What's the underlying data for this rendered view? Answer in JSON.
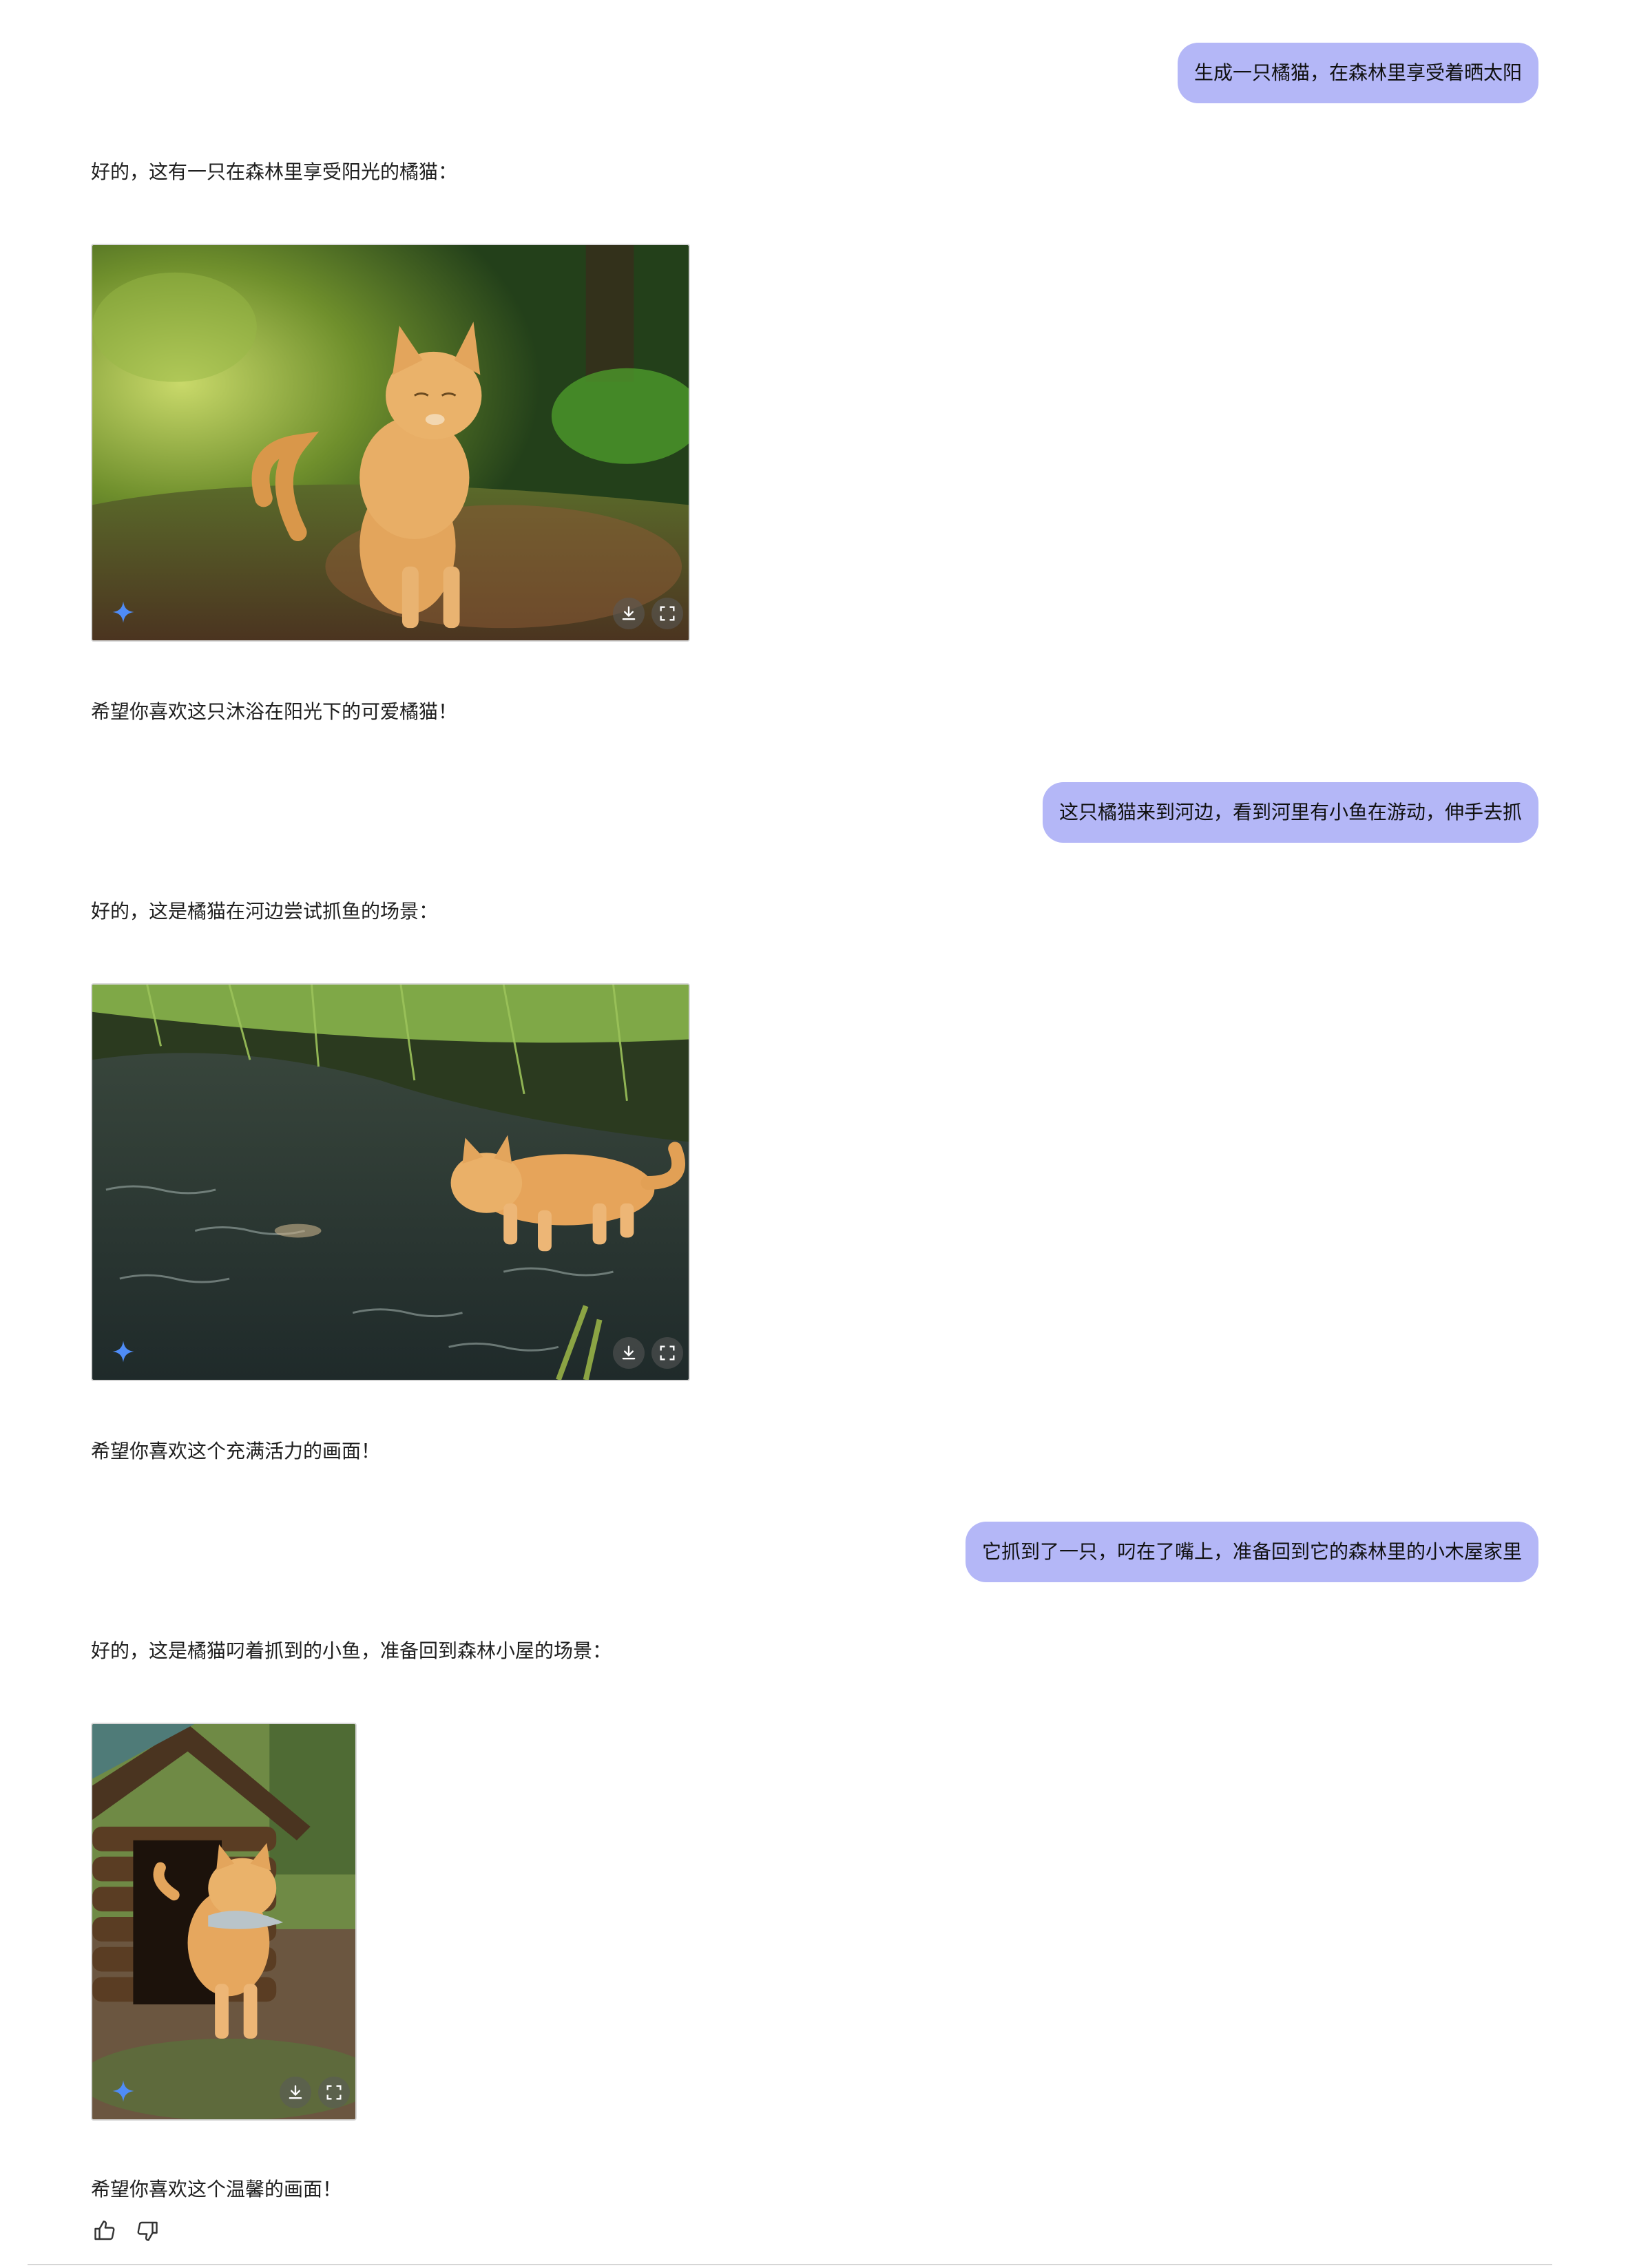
{
  "conversation": {
    "turn1": {
      "user_message": "生成一只橘猫，在森林里享受着晒太阳",
      "reply_intro": "好的，这有一只在森林里享受阳光的橘猫：",
      "reply_outro": "希望你喜欢这只沐浴在阳光下的可爱橘猫！"
    },
    "turn2": {
      "user_message": "这只橘猫来到河边，看到河里有小鱼在游动，伸手去抓",
      "reply_intro": "好的，这是橘猫在河边尝试抓鱼的场景：",
      "reply_outro": "希望你喜欢这个充满活力的画面！"
    },
    "turn3": {
      "user_message": "它抓到了一只，叼在了嘴上，准备回到它的森林里的小木屋家里",
      "reply_intro": "好的，这是橘猫叼着抓到的小鱼，准备回到森林小屋的场景：",
      "reply_outro": "希望你喜欢这个温馨的画面！"
    }
  },
  "icons": {
    "image_badge": "sparkle-icon",
    "image_actions": [
      "download-icon",
      "fullscreen-icon"
    ],
    "feedback": [
      "thumbs-up-icon",
      "thumbs-down-icon"
    ]
  },
  "colors": {
    "user_bubble": "#b4b7f7",
    "sparkle": "#4f8cf7",
    "background": "#ffffff"
  }
}
